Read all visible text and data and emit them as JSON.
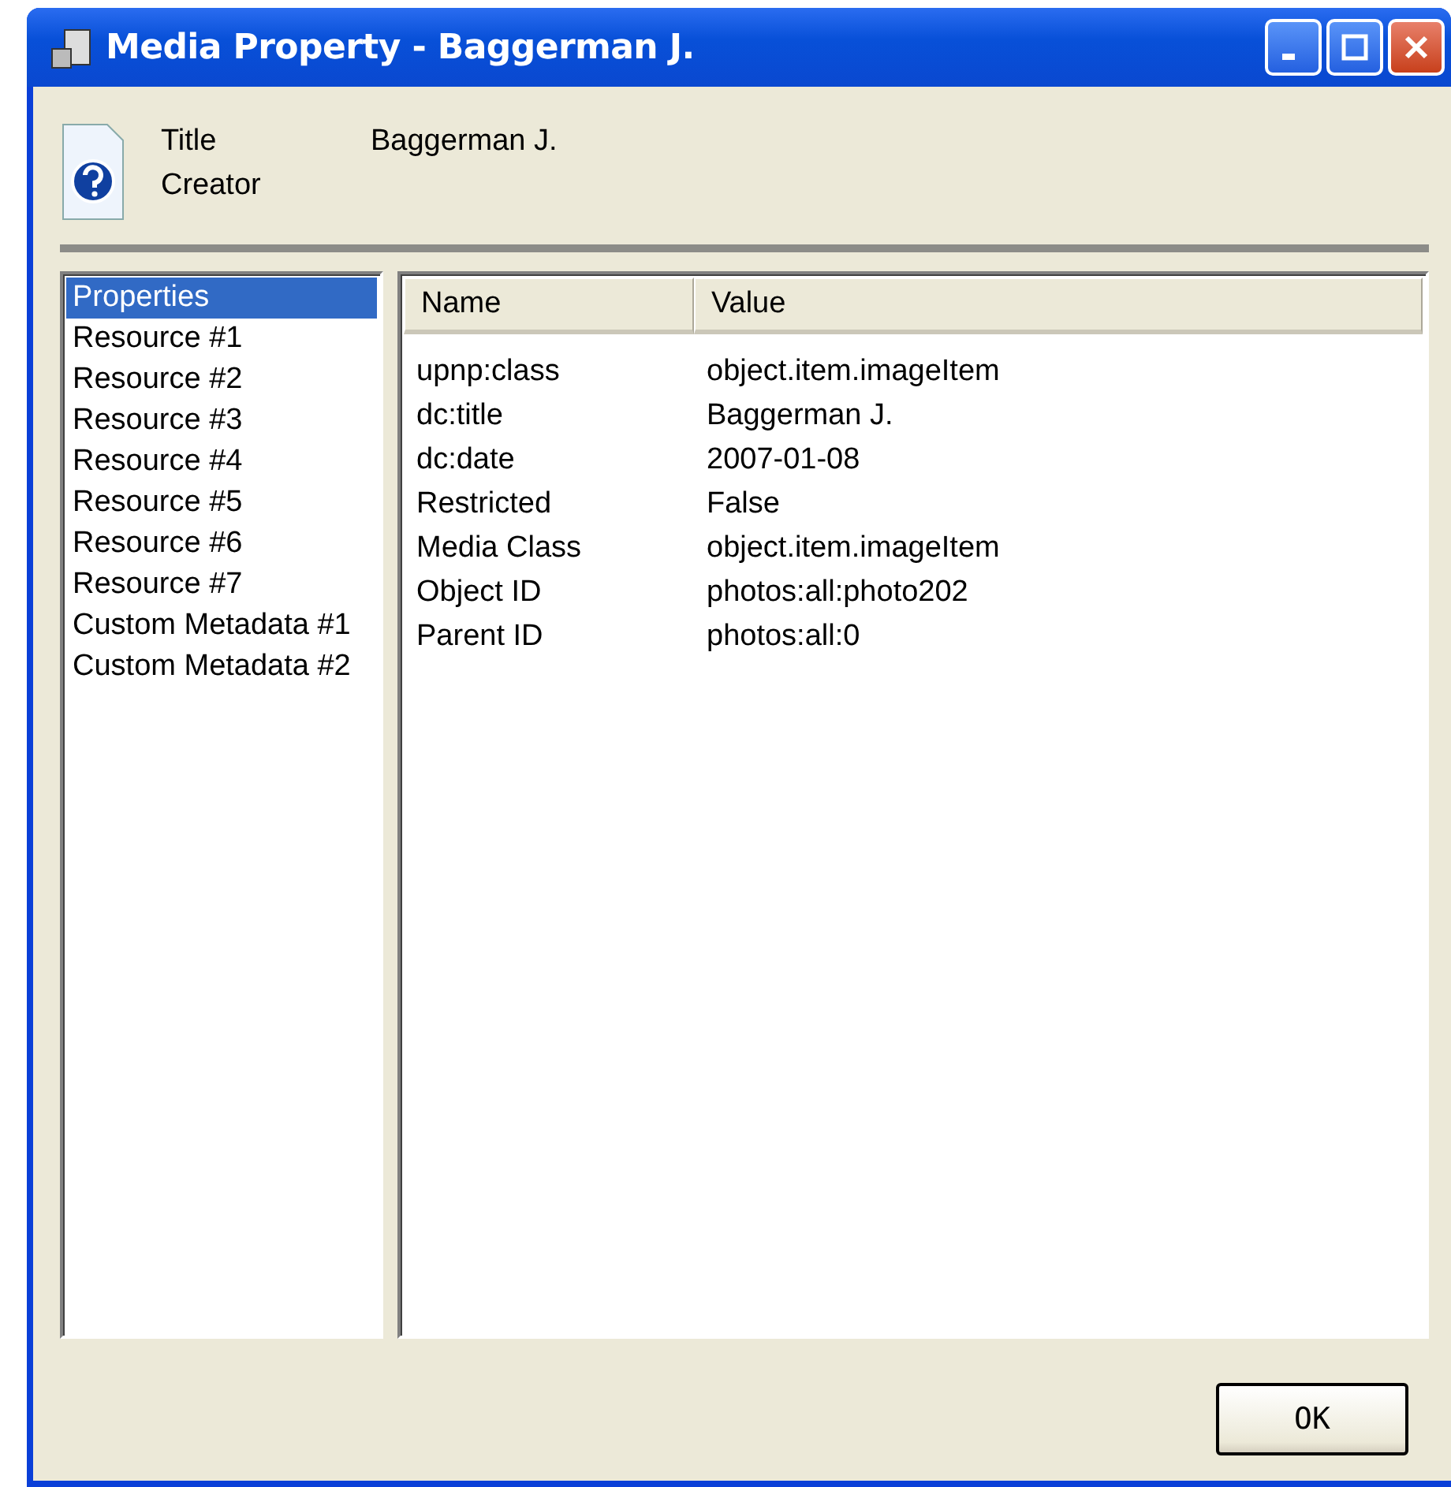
{
  "window": {
    "title": "Media Property - Baggerman J."
  },
  "header": {
    "fields": [
      {
        "label": "Title",
        "value": "Baggerman J."
      },
      {
        "label": "Creator"
      }
    ]
  },
  "sidebar": {
    "items": [
      {
        "label": "Properties",
        "selected": true
      },
      {
        "label": "Resource #1",
        "selected": false
      },
      {
        "label": "Resource #2",
        "selected": false
      },
      {
        "label": "Resource #3",
        "selected": false
      },
      {
        "label": "Resource #4",
        "selected": false
      },
      {
        "label": "Resource #5",
        "selected": false
      },
      {
        "label": "Resource #6",
        "selected": false
      },
      {
        "label": "Resource #7",
        "selected": false
      },
      {
        "label": "Custom Metadata #1",
        "selected": false
      },
      {
        "label": "Custom Metadata #2",
        "selected": false
      }
    ]
  },
  "table": {
    "columns": [
      "Name",
      "Value"
    ],
    "rows": [
      [
        "upnp:class",
        "object.item.imageItem"
      ],
      [
        "dc:title",
        "Baggerman J."
      ],
      [
        "dc:date",
        "2007-01-08"
      ],
      [
        "Restricted",
        "False"
      ],
      [
        "Media Class",
        "object.item.imageItem"
      ],
      [
        "Object ID",
        "photos:all:photo202"
      ],
      [
        "Parent ID",
        "photos:all:0"
      ]
    ]
  },
  "buttons": [
    "OK"
  ]
}
